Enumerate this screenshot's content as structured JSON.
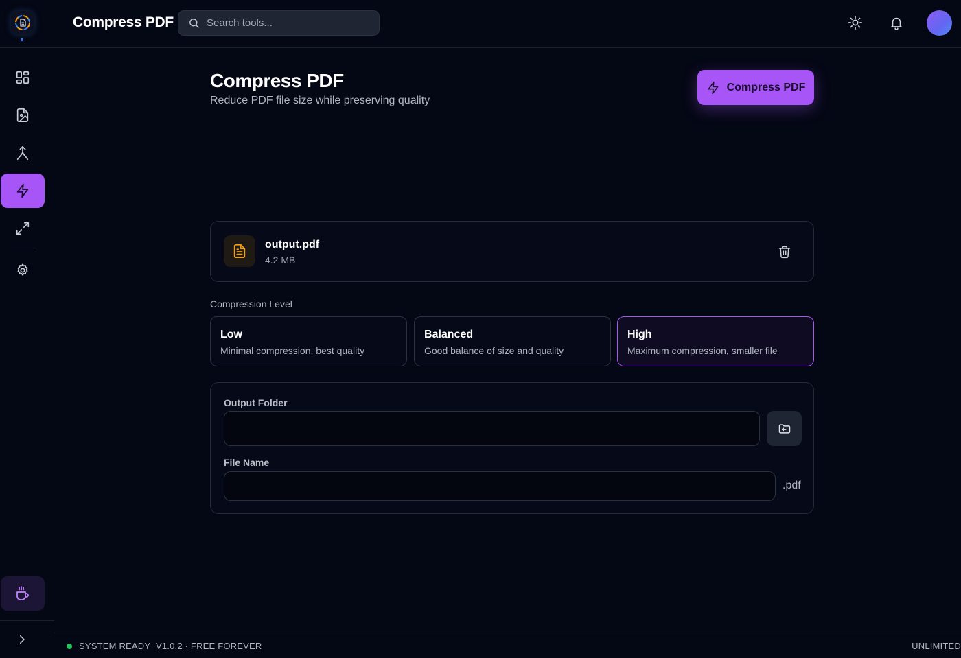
{
  "header": {
    "app_title": "Compress PDF",
    "search_placeholder": "Search tools..."
  },
  "sidebar": {
    "items": [
      {
        "name": "dashboard",
        "icon": "grid-icon",
        "active": false
      },
      {
        "name": "image-to-pdf",
        "icon": "file-image-icon",
        "active": false
      },
      {
        "name": "merge",
        "icon": "merge-icon",
        "active": false
      },
      {
        "name": "compress",
        "icon": "lightning-icon",
        "active": true
      },
      {
        "name": "resize",
        "icon": "expand-icon",
        "active": false
      },
      {
        "name": "settings",
        "icon": "gear-icon",
        "active": false
      }
    ],
    "support_icon": "coffee-icon",
    "expand_icon": "chevron-right-icon"
  },
  "main": {
    "title": "Compress PDF",
    "subtitle": "Reduce PDF file size while preserving quality",
    "action_label": "Compress PDF",
    "file": {
      "name": "output.pdf",
      "size": "4.2 MB"
    },
    "compression_label": "Compression Level",
    "levels": [
      {
        "title": "Low",
        "description": "Minimal compression, best quality",
        "selected": false
      },
      {
        "title": "Balanced",
        "description": "Good balance of size and quality",
        "selected": false
      },
      {
        "title": "High",
        "description": "Maximum compression, smaller file",
        "selected": true
      }
    ],
    "output": {
      "folder_label": "Output Folder",
      "folder_value": "",
      "file_name_label": "File Name",
      "file_name_value": "",
      "extension": ".pdf"
    }
  },
  "status": {
    "state": "SYSTEM READY",
    "version": "V1.0.2 · FREE FOREVER",
    "plan": "UNLIMITED"
  },
  "colors": {
    "background": "#040714",
    "accent": "#a855f7",
    "file_icon": "#f59e0b",
    "status_ok": "#22c55e"
  }
}
